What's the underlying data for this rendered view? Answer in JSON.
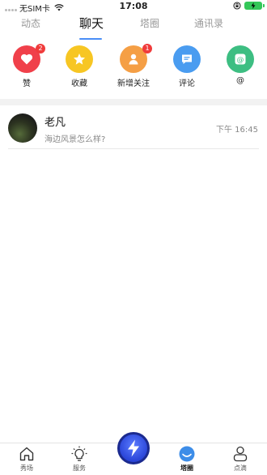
{
  "status_bar": {
    "carrier": "无SIM卡",
    "time": "17:08"
  },
  "top_tabs": [
    {
      "label": "动态",
      "active": false
    },
    {
      "label": "聊天",
      "active": true
    },
    {
      "label": "塔圈",
      "active": false
    },
    {
      "label": "通讯录",
      "active": false
    }
  ],
  "quick_actions": [
    {
      "label": "赞",
      "badge": "2",
      "icon": "heart-icon",
      "color": "#f0404a"
    },
    {
      "label": "收藏",
      "badge": "",
      "icon": "star-icon",
      "color": "#f7c623"
    },
    {
      "label": "新增关注",
      "badge": "1",
      "icon": "person-icon",
      "color": "#f59f45"
    },
    {
      "label": "评论",
      "badge": "",
      "icon": "comment-icon",
      "color": "#4a9cf0"
    },
    {
      "label": "@",
      "badge": "",
      "icon": "at-icon",
      "color": "#3dbe82"
    }
  ],
  "chats": [
    {
      "name": "老凡",
      "preview": "海边风景怎么样?",
      "time": "下午 16:45"
    }
  ],
  "bottom_nav": [
    {
      "label": "秀场",
      "icon": "home-icon",
      "active": false
    },
    {
      "label": "服务",
      "icon": "lightbulb-icon",
      "active": false
    },
    {
      "label": "",
      "icon": "lightning-icon",
      "active": false
    },
    {
      "label": "塔圈",
      "icon": "tower-circle-icon",
      "active": true
    },
    {
      "label": "点滴",
      "icon": "profile-icon",
      "active": false
    }
  ],
  "colors": {
    "accent": "#4a8ef7",
    "badge": "#f03b3b",
    "battery": "#34c759",
    "center_button": "#2a45d8"
  }
}
